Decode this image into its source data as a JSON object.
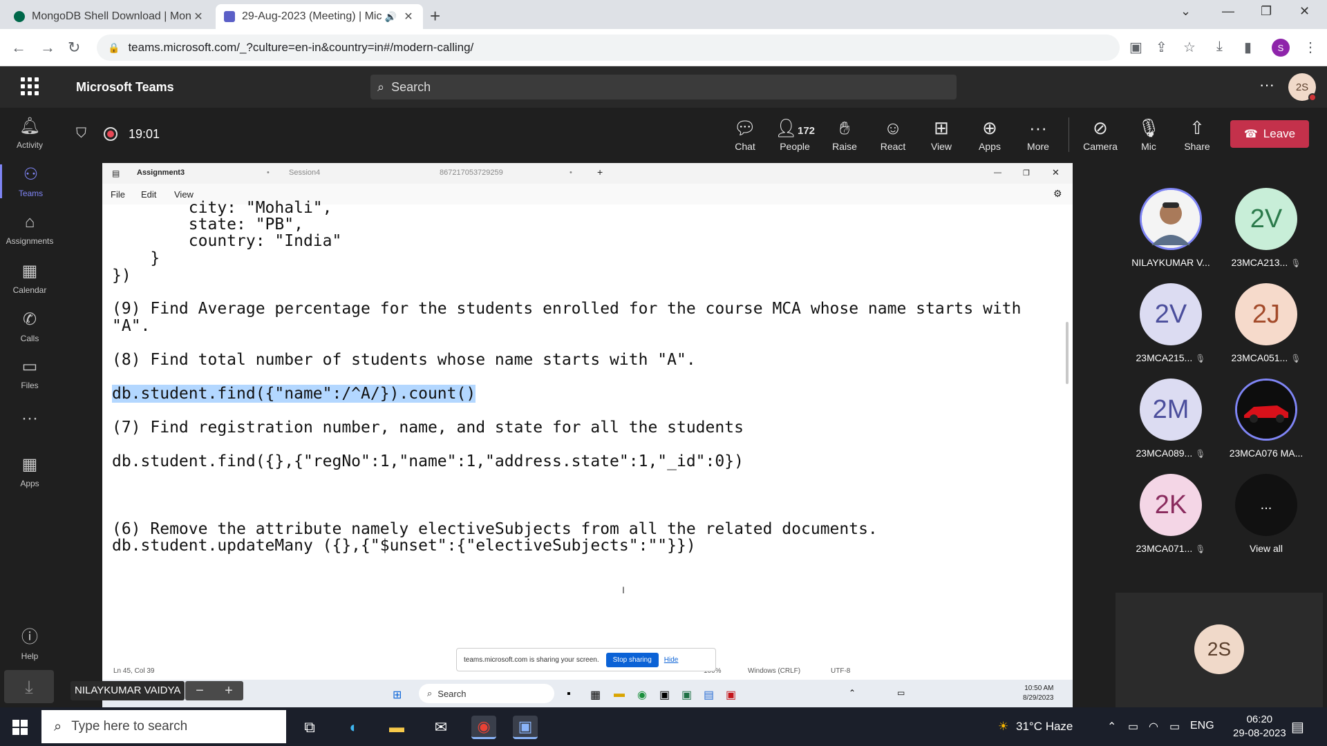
{
  "browser": {
    "tabs": [
      {
        "title": "MongoDB Shell Download | Mon",
        "favicon_color": "#00684a"
      },
      {
        "title": "29-Aug-2023 (Meeting) | Mic",
        "favicon_color": "#5b5fc7"
      }
    ],
    "url": "teams.microsoft.com/_?culture=en-in&country=in#/modern-calling/",
    "profile_initial": "S"
  },
  "teams": {
    "app_name": "Microsoft Teams",
    "search_placeholder": "Search",
    "avatar_initials": "2S",
    "rail": [
      {
        "label": "Activity",
        "icon": "bell-icon"
      },
      {
        "label": "Teams",
        "icon": "teams-icon"
      },
      {
        "label": "Assignments",
        "icon": "assignments-icon"
      },
      {
        "label": "Calendar",
        "icon": "calendar-icon"
      },
      {
        "label": "Calls",
        "icon": "phone-icon"
      },
      {
        "label": "Files",
        "icon": "file-icon"
      },
      {
        "label": "Apps",
        "icon": "apps-icon"
      },
      {
        "label": "Help",
        "icon": "help-icon"
      }
    ]
  },
  "meeting": {
    "timer": "19:01",
    "people_count": "172",
    "controls": {
      "chat": "Chat",
      "people": "People",
      "raise": "Raise",
      "react": "React",
      "view": "View",
      "apps": "Apps",
      "more": "More",
      "camera": "Camera",
      "mic": "Mic",
      "share": "Share",
      "leave": "Leave"
    },
    "presenter_name": "NILAYKUMAR VAIDYA"
  },
  "shared_screen": {
    "notepad_tabs": [
      "Assignment3",
      "Session4",
      "867217053729259"
    ],
    "menu": [
      "File",
      "Edit",
      "View"
    ],
    "code_lines": [
      "        city: \"Mohali\",",
      "        state: \"PB\",",
      "        country: \"India\"",
      "    }",
      "})",
      "(9) Find Average percentage for the students enrolled for the course MCA whose name starts with",
      "\"A\".",
      "(8) Find total number of students whose name starts with \"A\".",
      "db.student.find({\"name\":/^A/}).count()",
      "(7) Find registration number, name, and state for all the students",
      "db.student.find({},{\"regNo\":1,\"name\":1,\"address.state\":1,\"_id\":0})",
      "(6) Remove the attribute namely electiveSubjects from all the related documents.",
      "db.student.updateMany ({},{\"$unset\":{\"electiveSubjects\":\"\"}})"
    ],
    "status": {
      "position": "Ln 45, Col 39",
      "zoom": "100%",
      "line_ending": "Windows (CRLF)",
      "encoding": "UTF-8"
    },
    "share_banner": {
      "text": "teams.microsoft.com is sharing your screen.",
      "stop": "Stop sharing",
      "hide": "Hide"
    },
    "inner_taskbar": {
      "search": "Search",
      "time": "10:50 AM",
      "date": "8/29/2023"
    }
  },
  "participants": [
    {
      "name": "NILAYKUMAR V...",
      "initials": "",
      "color": "#ffffff",
      "muted": false,
      "photo": true
    },
    {
      "name": "23MCA213...",
      "initials": "2V",
      "color": "#c8eed8",
      "muted": true,
      "photo": false
    },
    {
      "name": "23MCA215...",
      "initials": "2V",
      "color": "#dcdcf2",
      "muted": true,
      "photo": false
    },
    {
      "name": "23MCA051...",
      "initials": "2J",
      "color": "#f6dacb",
      "muted": true,
      "photo": false
    },
    {
      "name": "23MCA089...",
      "initials": "2M",
      "color": "#dcdcf2",
      "muted": true,
      "photo": false
    },
    {
      "name": "23MCA076 MA...",
      "initials": "",
      "color": "#111111",
      "muted": false,
      "photo": true
    },
    {
      "name": "23MCA071...",
      "initials": "2K",
      "color": "#f4d6e6",
      "muted": true,
      "photo": false
    },
    {
      "name": "View all",
      "initials": "...",
      "color": "#111111",
      "muted": false,
      "photo": false
    }
  ],
  "self_tile": {
    "initials": "2S"
  },
  "os_taskbar": {
    "search_placeholder": "Type here to search",
    "weather": "31°C Haze",
    "language": "ENG",
    "time": "06:20",
    "date": "29-08-2023"
  }
}
